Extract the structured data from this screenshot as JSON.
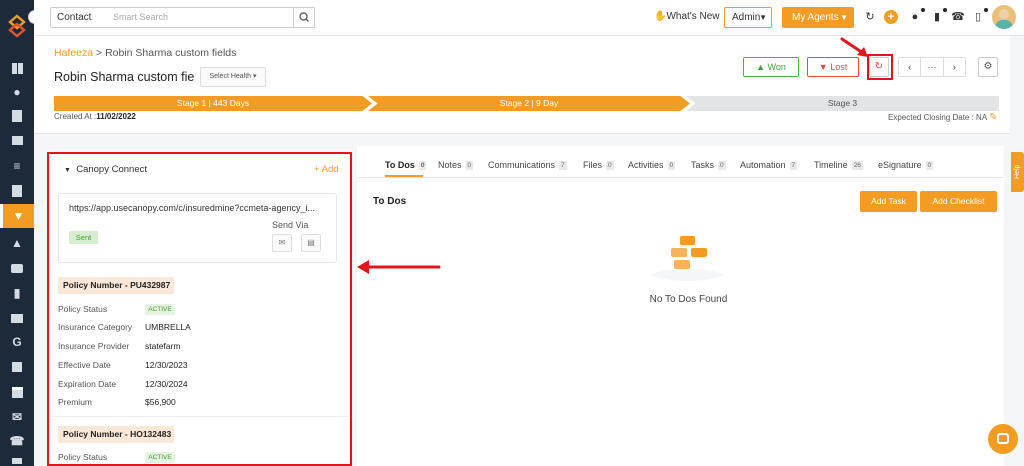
{
  "topbar": {
    "context_select": "Contact",
    "search_placeholder": "Smart Search",
    "whats_new": "What's New",
    "admin": "Admin",
    "my_agents": "My Agents"
  },
  "header": {
    "breadcrumb_link": "Hafeeza",
    "breadcrumb_sep": " > ",
    "breadcrumb_current": "Robin Sharma custom fields",
    "title": "Robin Sharma custom fie",
    "health_select": "Select Health",
    "won": "Won",
    "lost": "Lost",
    "nav_dots": "···",
    "stages": [
      {
        "label": "Stage 1 | 443 Days"
      },
      {
        "label": "Stage 2 | 9 Day"
      },
      {
        "label": "Stage 3"
      }
    ],
    "created_label": "Created At :",
    "created_value": "11/02/2022",
    "closing_label": "Expected Closing Date : NA"
  },
  "canopy": {
    "title": "Canopy Connect",
    "add": "+ Add",
    "url": "https://app.usecanopy.com/c/insuredmine?ccmeta-agency_i...",
    "send_via": "Send Via",
    "sent": "Sent",
    "policies": [
      {
        "title": "Policy Number - PU432987",
        "status_label": "Policy Status",
        "status": "ACTIVE",
        "rows": [
          {
            "label": "Insurance Category",
            "value": "UMBRELLA"
          },
          {
            "label": "Insurance Provider",
            "value": "statefarm"
          },
          {
            "label": "Effective Date",
            "value": "12/30/2023"
          },
          {
            "label": "Expiration Date",
            "value": "12/30/2024"
          },
          {
            "label": "Premium",
            "value": "$56,900"
          }
        ]
      },
      {
        "title": "Policy Number - HO132483",
        "status_label": "Policy Status",
        "status": "ACTIVE"
      }
    ]
  },
  "tabs": [
    {
      "label": "To Dos",
      "count": "0"
    },
    {
      "label": "Notes",
      "count": "0"
    },
    {
      "label": "Communications",
      "count": "7"
    },
    {
      "label": "Files",
      "count": "0"
    },
    {
      "label": "Activities",
      "count": "0"
    },
    {
      "label": "Tasks",
      "count": "0"
    },
    {
      "label": "Automation",
      "count": "7"
    },
    {
      "label": "Timeline",
      "count": "26"
    },
    {
      "label": "eSignature",
      "count": "0"
    }
  ],
  "todos": {
    "title": "To Dos",
    "add_task": "Add Task",
    "add_checklist": "Add Checklist",
    "empty": "No To Dos Found"
  },
  "help": "Help",
  "colors": {
    "accent": "#f39c23",
    "sidebar": "#1d2a3a",
    "highlight": "#e3141b",
    "won": "#4caf50",
    "lost": "#e64a3c"
  }
}
